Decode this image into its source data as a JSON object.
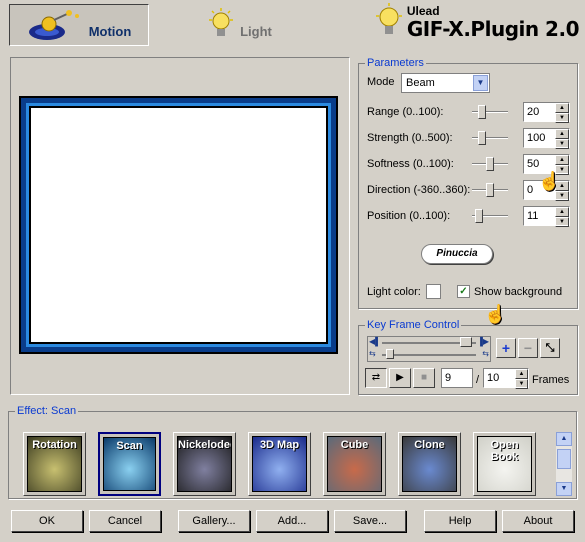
{
  "tabs": [
    {
      "label": "Motion",
      "active": true
    },
    {
      "label": "Light",
      "active": false
    }
  ],
  "brand": {
    "company": "Ulead",
    "product": "GIF-X.Plugin 2.0"
  },
  "parameters": {
    "title": "Parameters",
    "mode_label": "Mode",
    "mode_value": "Beam",
    "rows": [
      {
        "label": "Range (0..100):",
        "value": "20",
        "level": 0.2
      },
      {
        "label": "Strength (0..500):",
        "value": "100",
        "level": 0.2
      },
      {
        "label": "Softness (0..100):",
        "value": "50",
        "level": 0.5
      },
      {
        "label": "Direction (-360..360):",
        "value": "0",
        "level": 0.5
      },
      {
        "label": "Position (0..100):",
        "value": "11",
        "level": 0.11
      }
    ],
    "author_badge": "Pinuccia",
    "light_color_label": "Light color:",
    "light_color": "#ffffff",
    "show_background_label": "Show background",
    "show_background_checked": true
  },
  "keyframe": {
    "title": "Key Frame Control",
    "current_frame": "9",
    "total_frames": "10",
    "frames_label": "Frames",
    "separator": "/"
  },
  "effects": {
    "title": "Effect: Scan",
    "items": [
      {
        "label": "Rotation",
        "colors": [
          "#3a3a20",
          "#c8c070"
        ]
      },
      {
        "label": "Scan",
        "colors": [
          "#0a3a6a",
          "#8ad0f0"
        ],
        "selected": true
      },
      {
        "label": "Nickelodeon",
        "colors": [
          "#1a1a1a",
          "#8080a0"
        ]
      },
      {
        "label": "3D Map",
        "colors": [
          "#1a2a8a",
          "#90b0f0"
        ]
      },
      {
        "label": "Cube",
        "colors": [
          "#5a6a7a",
          "#c86a4a"
        ]
      },
      {
        "label": "Clone",
        "colors": [
          "#3a3a3a",
          "#6a8ad0"
        ]
      },
      {
        "label": "Open Book",
        "colors": [
          "#d0d0c8",
          "#f4f4f0"
        ]
      }
    ]
  },
  "buttons": {
    "ok": "OK",
    "cancel": "Cancel",
    "gallery": "Gallery...",
    "add": "Add...",
    "save": "Save...",
    "help": "Help",
    "about": "About"
  },
  "colors": {
    "accent": "#0a3ad1",
    "preview_border": "#2b8ae0"
  }
}
